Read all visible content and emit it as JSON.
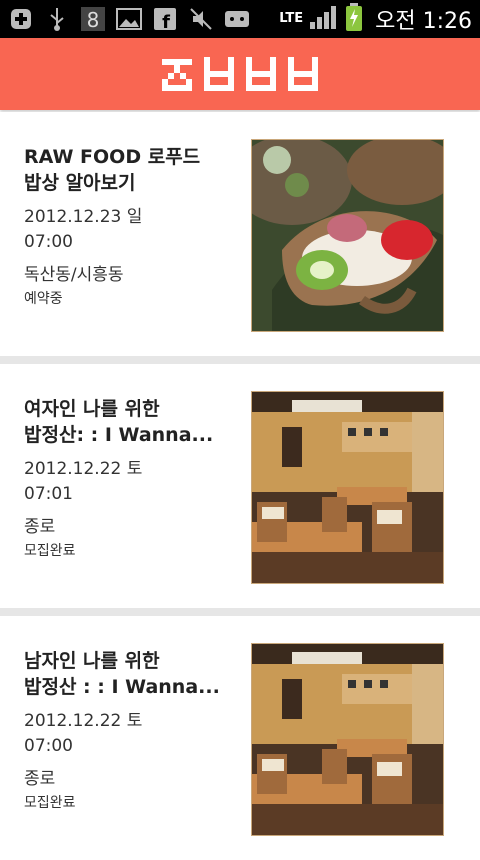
{
  "status_bar": {
    "icons": [
      "add-icon",
      "usb-icon",
      "app-icon",
      "image-icon",
      "facebook-icon",
      "mute-icon",
      "mail-icon",
      "lte-signal-icon",
      "battery-charging-icon"
    ],
    "network_label": "LTE",
    "time": "오전 1:26"
  },
  "header": {
    "logo_text": "ㅈㅂㅂㅂ",
    "color": "#f96652"
  },
  "events": [
    {
      "title": "RAW FOOD 로푸드\n밥상 알아보기",
      "date": "2012.12.23 일",
      "time": "07:00",
      "place": "독산동/시흥동",
      "status": "예약중",
      "image": "crepe-food-photo"
    },
    {
      "title": "여자인 나를 위한\n밥정산: : I Wanna...",
      "date": "2012.12.22 토",
      "time": "07:01",
      "place": "종로",
      "status": "모집완료",
      "image": "restaurant-interior-photo"
    },
    {
      "title": "남자인 나를 위한\n밥정산 : : I Wanna...",
      "date": "2012.12.22 토",
      "time": "07:00",
      "place": "종로",
      "status": "모집완료",
      "image": "restaurant-interior-photo"
    }
  ]
}
